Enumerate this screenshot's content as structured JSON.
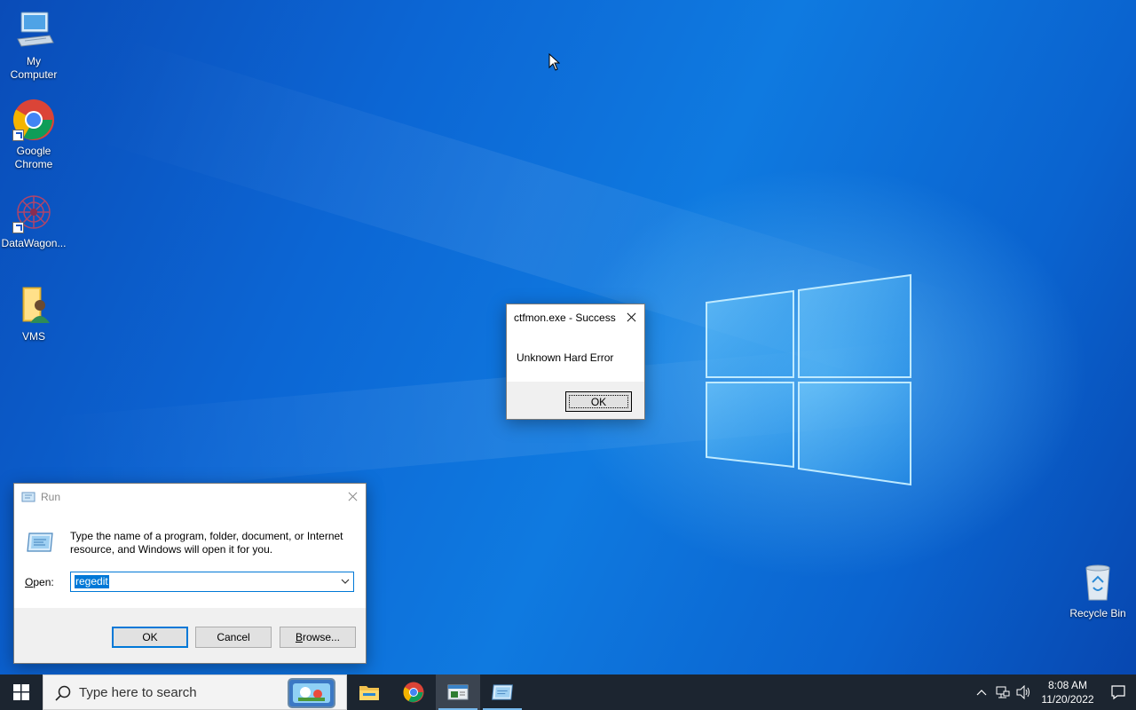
{
  "desktop": {
    "icons": [
      {
        "label_line1": "My",
        "label_line2": "Computer",
        "icon": "computer-icon"
      },
      {
        "label_line1": "Google",
        "label_line2": "Chrome",
        "icon": "chrome-icon"
      },
      {
        "label_line1": "DataWagon...",
        "label_line2": "",
        "icon": "datawagon-icon"
      },
      {
        "label_line1": "VMS",
        "label_line2": "",
        "icon": "folder-user-icon"
      },
      {
        "label_line1": "Recycle Bin",
        "label_line2": "",
        "icon": "recycle-bin-icon"
      }
    ]
  },
  "message_box": {
    "title": "ctfmon.exe - Success",
    "message": "Unknown Hard Error",
    "ok_label": "OK"
  },
  "run_dialog": {
    "title": "Run",
    "description": "Type the name of a program, folder, document, or Internet resource, and Windows will open it for you.",
    "open_label": "Open:",
    "open_value": "regedit",
    "ok_label": "OK",
    "cancel_label": "Cancel",
    "browse_label": "Browse..."
  },
  "taskbar": {
    "search_placeholder": "Type here to search",
    "apps": [
      "file-explorer-icon",
      "chrome-icon",
      "terminal-window-icon",
      "run-icon"
    ],
    "clock_time": "8:08 AM",
    "clock_date": "11/20/2022"
  },
  "colors": {
    "accent": "#0078d7",
    "taskbar": "#1c2530",
    "dialog_footer": "#f0f0f0"
  }
}
